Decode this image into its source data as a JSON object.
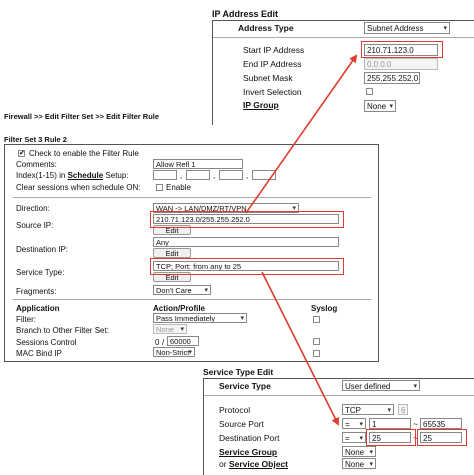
{
  "ip_panel": {
    "title": "IP Address Edit",
    "address_type_label": "Address Type",
    "address_type_value": "Subnet Address",
    "start_ip_label": "Start IP Address",
    "start_ip_value": "210.71.123.0",
    "end_ip_label": "End IP Address",
    "end_ip_value": "0.0.0.0",
    "subnet_mask_label": "Subnet Mask",
    "subnet_mask_value": "255.255.252.0",
    "invert_label": "Invert Selection",
    "ip_group_label": "IP Group",
    "ip_group_value": "None"
  },
  "breadcrumb": "Firewall >> Edit Filter Set >> Edit Filter Rule",
  "filter_panel": {
    "title": "Filter Set 3 Rule 2",
    "enable_label": "Check to enable the Filter Rule",
    "comments_label": "Comments:",
    "comments_value": "Allow Refl 1",
    "index_label": "Index(1-15) in",
    "schedule_label": "Schedule",
    "setup_label": "Setup:",
    "index_sep": ",",
    "clear_label": "Clear sessions when schedule ON:",
    "clear_enable_label": "Enable",
    "direction_label": "Direction:",
    "direction_value": "WAN -> LAN/DMZ/RT/VPN",
    "source_ip_label": "Source IP:",
    "source_ip_value": "210.71.123.0/255.255.252.0",
    "edit_label": "Edit",
    "dest_ip_label": "Destination IP:",
    "dest_ip_value": "Any",
    "service_type_label": "Service Type:",
    "service_type_value": "TCP; Port: from any to 25",
    "fragments_label": "Fragments:",
    "fragments_value": "Don't Care",
    "col_application": "Application",
    "col_action": "Action/Profile",
    "col_syslog": "Syslog",
    "filter_label": "Filter:",
    "filter_value": "Pass Immediately",
    "branch_label": "Branch to Other Filter Set:",
    "branch_value": "None",
    "sessions_label": "Sessions Control",
    "sessions_current": "0",
    "sessions_sep": "/",
    "sessions_max": "60000",
    "macbind_label": "MAC Bind IP",
    "macbind_value": "Non-Strict"
  },
  "service_panel": {
    "title": "Service Type Edit",
    "service_type_label": "Service Type",
    "service_type_value": "User defined",
    "protocol_label": "Protocol",
    "protocol_value": "TCP",
    "protocol_number": "6",
    "source_port_label": "Source Port",
    "source_port_op": "=",
    "source_port_from": "1",
    "source_port_to": "65535",
    "dest_port_label": "Destination Port",
    "dest_port_op": "=",
    "dest_port_from": "25",
    "dest_port_to": "25",
    "tilde": "~",
    "service_group_label": "Service Group",
    "service_group_value": "None",
    "or_label": "or",
    "service_object_label": "Service Object",
    "service_object_value": "None"
  },
  "colors": {
    "highlight": "#e03b2c",
    "header_bg": "#ffffff",
    "border": "#555555"
  }
}
